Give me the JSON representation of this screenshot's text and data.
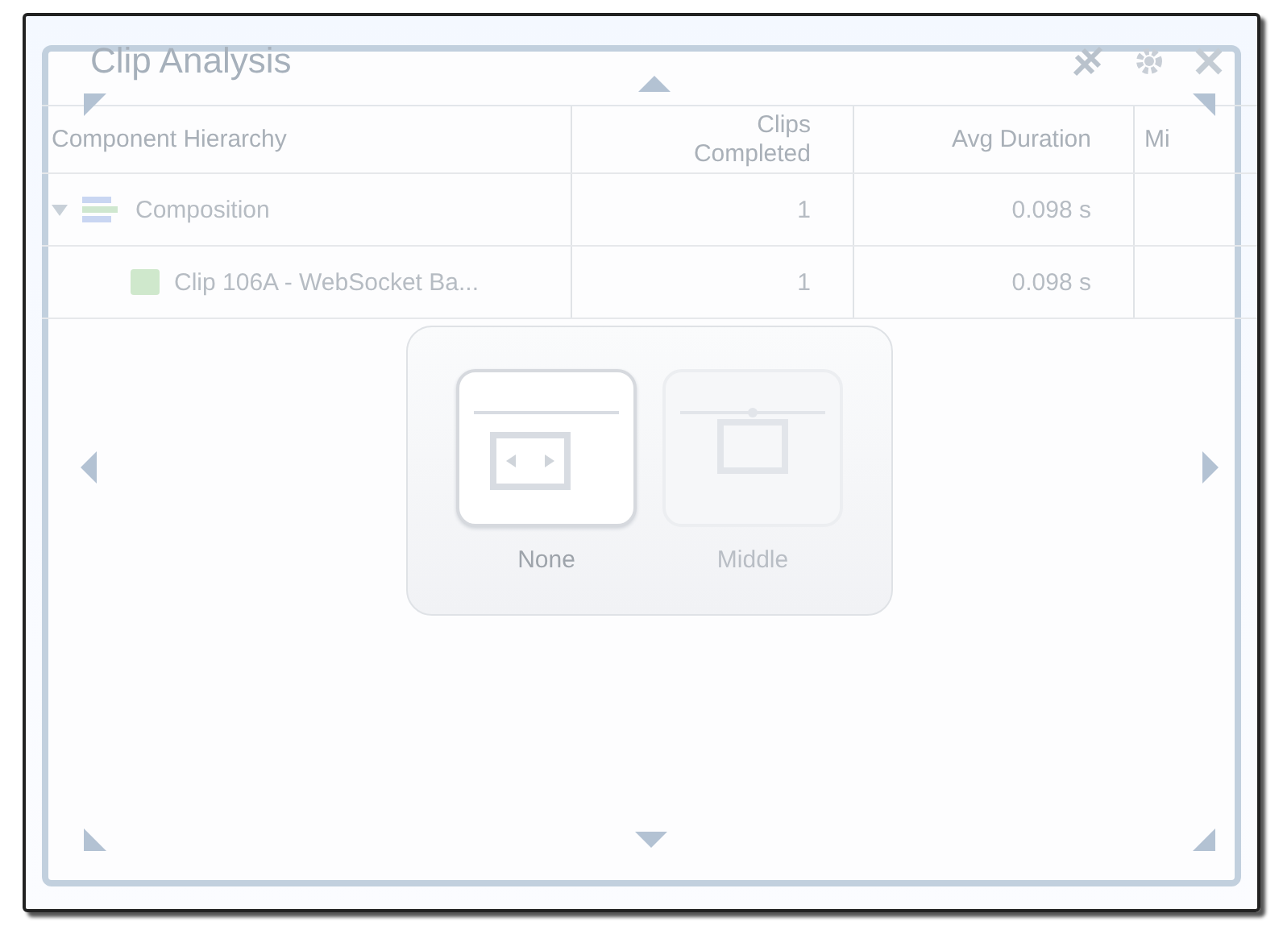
{
  "window": {
    "title": "Clip Analysis"
  },
  "table": {
    "columns": [
      "Component Hierarchy",
      "Clips Completed",
      "Avg Duration",
      "Mi"
    ],
    "rows": [
      {
        "name": "Composition",
        "expanded": true,
        "clips": "1",
        "avg": "0.098 s",
        "children": [
          {
            "name": "Clip 106A - WebSocket Ba...",
            "clips": "1",
            "avg": "0.098 s"
          }
        ]
      }
    ]
  },
  "dock_options": [
    {
      "label": "None",
      "selected": true,
      "disabled": false
    },
    {
      "label": "Middle",
      "selected": false,
      "disabled": true
    }
  ]
}
